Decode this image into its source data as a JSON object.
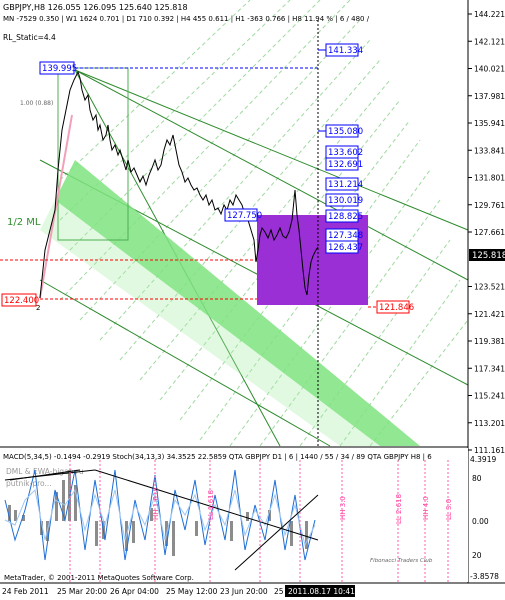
{
  "header": {
    "line1": "GBPJPY,H8  126.055 126.095 125.640 125.818",
    "line2": "MN -7529  0.350 | W1 1624  0.701 | D1  710  0.392 | H4  455  0.611 | H1  -363  0.766 | H8  11.94 % | 6 / 480 /",
    "line3": "RL_Static=4.4"
  },
  "price_axis": {
    "ticks": [
      "144.221",
      "142.121",
      "140.021",
      "137.981",
      "135.941",
      "133.841",
      "131.801",
      "129.761",
      "127.661",
      "125.818",
      "123.521",
      "121.421",
      "119.381",
      "117.341",
      "115.241",
      "113.201",
      "111.161"
    ],
    "current_price": "125.818"
  },
  "levels": [
    {
      "label": "141.334"
    },
    {
      "label": "135.080"
    },
    {
      "label": "133.602"
    },
    {
      "label": "132.691"
    },
    {
      "label": "131.214"
    },
    {
      "label": "130.019"
    },
    {
      "label": "128.825"
    },
    {
      "label": "127.348"
    },
    {
      "label": "126.437"
    },
    {
      "label": "121.846"
    }
  ],
  "left_boxes": [
    {
      "label": "139.995"
    },
    {
      "label": "122.400"
    },
    {
      "label": "127.750"
    }
  ],
  "annotations": {
    "half_ml": "1/2 ML",
    "fib_100": "1.00 (0.88)",
    "point_two": "2"
  },
  "indicator": {
    "header": "MACD(5,34,5) -0.1494 -0.2919  Stoch(34,13,3) 34.3525 22.5859  QTA GBPJPY D1 | 6 | 1440 / 55 / 34 / 89  QTA GBPJPY H8 | 6",
    "scale": [
      "4.3919",
      "80",
      "0.00",
      "20",
      "-3.8578"
    ],
    "legend": [
      "DML & EWA-bigan.ru",
      "putnik-pro..."
    ],
    "watermark": "Fibonacci Traders Club",
    "copyright": "MetaTrader, © 2001-2011 MetaQuotes Software Corp.",
    "tags": [
      "HH 3.0",
      "LL 2.618",
      "HH 4.0",
      "LL 3.0",
      "LL 1.618",
      "HH 1.618"
    ]
  },
  "time_axis": {
    "labels": [
      "24 Feb 2011",
      "25 Mar 20:00",
      "26 Apr 04:00",
      "25 May 12:00",
      "23 Jun 20:00",
      "25"
    ],
    "cursor": "2011.08.17 10:41"
  },
  "colors": {
    "bg": "#ffffff",
    "channel_green": "#7fe37f",
    "pitchfork_line": "#2e8b2e",
    "box_purple": "#9a2fd6",
    "level_blue": "#0000ff",
    "red_dashed": "#ff0000",
    "price_marker": "#000000"
  }
}
